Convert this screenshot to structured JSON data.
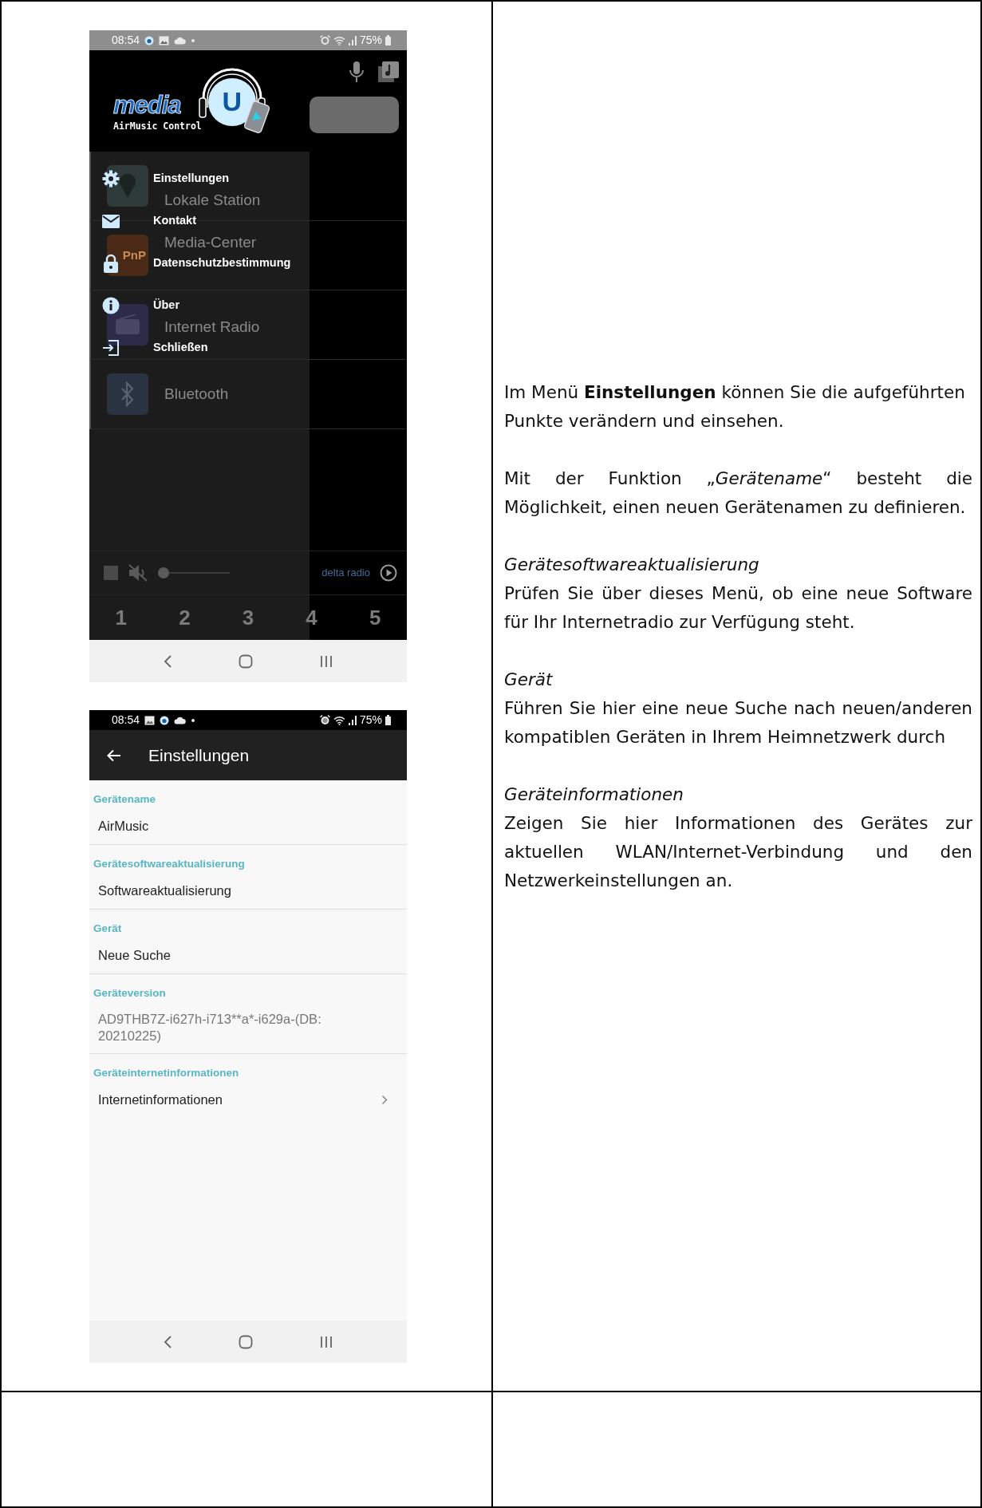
{
  "menu_screen": {
    "status_bar": {
      "time": "08:54",
      "battery": "75%"
    },
    "logo": {
      "wordmark": "media",
      "tagline": "AirMusic Control",
      "emblem_letter": "U"
    },
    "stations": [
      {
        "label": "Lokale Station",
        "kind": "local"
      },
      {
        "label": "Media-Center",
        "kind": "upnp",
        "badge": "PnP"
      },
      {
        "label": "Internet Radio",
        "kind": "radio"
      },
      {
        "label": "Bluetooth",
        "kind": "bluetooth"
      }
    ],
    "drawer_items": [
      {
        "label": "Einstellungen"
      },
      {
        "label": "Kontakt"
      },
      {
        "label": "Datenschutzbestimmung"
      },
      {
        "label": "Über"
      },
      {
        "label": "Schließen"
      }
    ],
    "player": {
      "station": "delta radio",
      "muted": true,
      "level": 0
    },
    "presets": [
      "1",
      "2",
      "3",
      "4",
      "5"
    ]
  },
  "settings_screen": {
    "status_bar": {
      "time": "08:54",
      "battery": "75%"
    },
    "title": "Einstellungen",
    "sections": [
      {
        "header": "Gerätename",
        "value": "AirMusic",
        "kind": "text"
      },
      {
        "header": "Gerätesoftwareaktualisierung",
        "value": "Softwareaktualisierung",
        "kind": "text"
      },
      {
        "header": "Gerät",
        "value": "Neue Suche",
        "kind": "text"
      },
      {
        "header": "Geräteversion",
        "value": "AD9THB7Z-i627h-i713**a*-i629a-(DB: 20210225)",
        "kind": "info"
      },
      {
        "header": "Geräteinternetinformationen",
        "value": "Internetinformationen",
        "kind": "link"
      }
    ]
  },
  "description": [
    {
      "text": "Im Menü **Einstellungen** können Sie die aufgeführten Punkte verändern und einsehen.",
      "justified": false
    },
    {
      "text": "Mit der Funktion „*Gerätename*“ besteht die Möglichkeit, einen neuen Gerätenamen zu definieren.",
      "justified": true
    },
    {
      "heading": "Gerätesoftwareaktualisierung",
      "text": "Prüfen Sie über dieses Menü, ob eine neue Software für Ihr Internetradio zur Verfügung steht.",
      "justified": true
    },
    {
      "heading": "Gerät",
      "text": "Führen Sie hier eine neue Suche nach neuen/anderen kompatiblen Geräten in Ihrem Heimnetzwerk durch",
      "justified": true
    },
    {
      "heading": "Geräteinformationen",
      "text": "Zeigen Sie hier Informationen des Gerätes zur aktuellen WLAN/Internet-Verbindung und den Netzwerkeinstellungen an.",
      "justified": true
    }
  ]
}
